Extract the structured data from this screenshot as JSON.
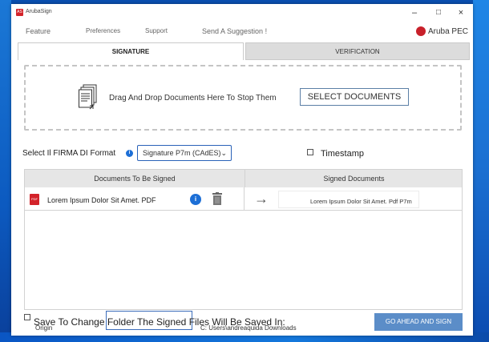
{
  "window": {
    "title": "ArubaSign",
    "app_icon_glyph": "AS",
    "controls": {
      "minimize": "–",
      "maximize": "□",
      "close": "×"
    }
  },
  "menu": {
    "items": [
      "Feature",
      "Preferences",
      "Support",
      "Send A Suggestion !"
    ],
    "brand": "Aruba PEC"
  },
  "tabs": [
    {
      "label": "SIGNATURE",
      "active": true
    },
    {
      "label": "VERIFICATION",
      "active": false
    }
  ],
  "dropzone": {
    "text": "Drag And Drop Documents Here To Stop Them",
    "button": "SELECT DOCUMENTS"
  },
  "format": {
    "label": "Select Il FIRMA DI Format",
    "info_glyph": "i",
    "selected": "Signature P7m (CAdES)"
  },
  "timestamp": {
    "label": "Timestamp",
    "checked": false
  },
  "table": {
    "headers": [
      "Documents To Be Signed",
      "Signed Documents"
    ],
    "rows": [
      {
        "icon": "pdf-icon",
        "icon_text": "PDF",
        "name": "Lorem Ipsum Dolor Sit Amet. PDF",
        "arrow": "→",
        "signed_name": "Lorem Ipsum Dolor Sit Amet. Pdf P7m"
      }
    ]
  },
  "footer": {
    "save_label": "Save To Change Folder The Signed Files Will Be Saved In:",
    "origin_label": "Origin",
    "path": "C: Users\\andreaquida Downloads",
    "go_button": "GO AHEAD AND SIGN"
  },
  "colors": {
    "accent": "#1d6fd6",
    "brand_red": "#d3232a",
    "go_button": "#5b8dc8",
    "inactive_tab": "#dcdcdc",
    "table_header": "#e6e6e6"
  }
}
